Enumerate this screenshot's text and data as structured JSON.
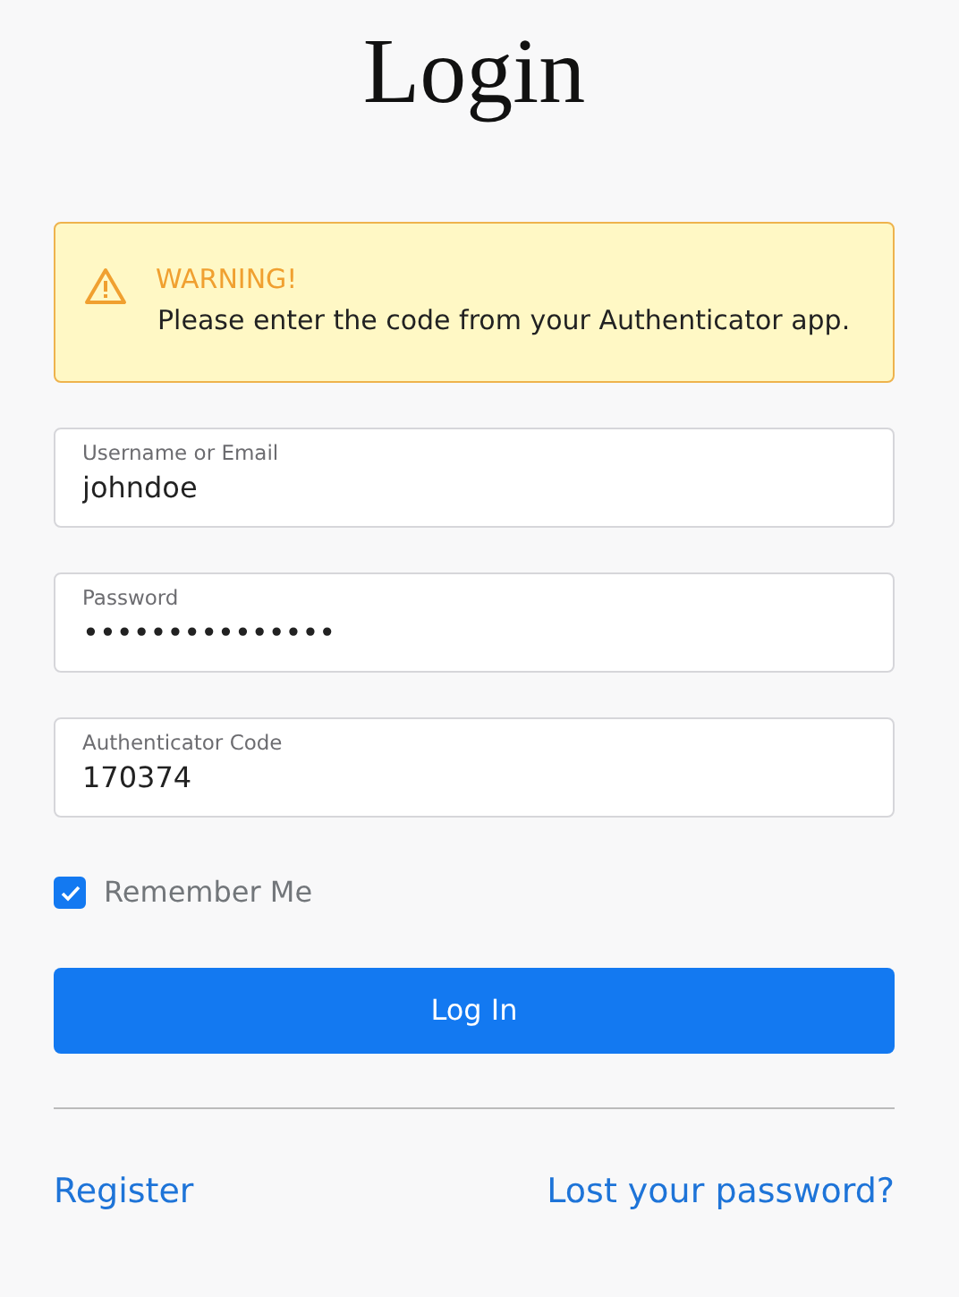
{
  "title": "Login",
  "alert": {
    "kind": "warning",
    "heading": "WARNING!",
    "message": "Please enter the code from your Authenticator app."
  },
  "fields": [
    {
      "label": "Username or Email",
      "value": "johndoe"
    },
    {
      "label": "Password",
      "value": "•••••••••••••••"
    },
    {
      "label": "Authenticator Code",
      "value": "170374"
    }
  ],
  "remember": {
    "label": "Remember Me",
    "checked": true
  },
  "button": "Log In",
  "links": [
    "Register",
    "Lost your password?"
  ]
}
